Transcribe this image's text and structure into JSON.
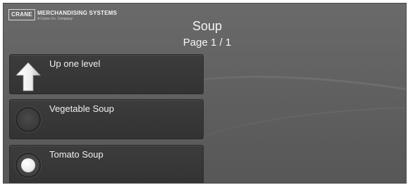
{
  "logo": {
    "box_text": "CRANE",
    "name": "MERCHANDISING SYSTEMS",
    "tagline": "A Crane Co. Company"
  },
  "header": {
    "title": "Soup",
    "page_info": "Page 1 / 1"
  },
  "menu": {
    "items": [
      {
        "label": "Up one level",
        "icon": "up-arrow-icon"
      },
      {
        "label": "Vegetable Soup",
        "icon": "radio-unselected-icon",
        "selected": false
      },
      {
        "label": "Tomato Soup",
        "icon": "radio-selected-icon",
        "selected": true
      }
    ]
  },
  "colors": {
    "background": "#606060",
    "button": "#383838",
    "text": "#f2f2f2"
  }
}
